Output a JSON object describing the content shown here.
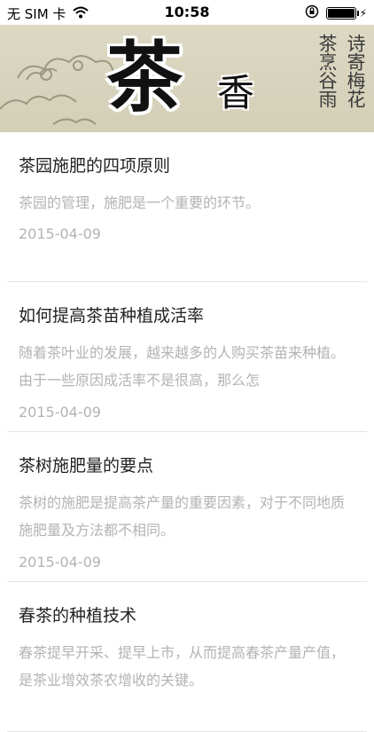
{
  "status_bar": {
    "carrier": "无 SIM 卡",
    "time": "10:58",
    "wifi_icon": "wifi-icon",
    "rotation_lock_icon": "rotation-lock-icon",
    "battery_icon": "battery-icon",
    "charging_icon": "charging-bolt-icon"
  },
  "banner": {
    "title": "茶",
    "subtitle": "香",
    "poem_columns": [
      "诗寄梅花",
      "茶烹谷雨"
    ]
  },
  "articles": [
    {
      "title": "茶园施肥的四项原则",
      "summary": "茶园的管理，施肥是一个重要的环节。",
      "date": "2015-04-09"
    },
    {
      "title": "如何提高茶苗种植成活率",
      "summary": "随着茶叶业的发展，越来越多的人购买茶苗来种植。由于一些原因成活率不是很高，那么怎",
      "date": "2015-04-09"
    },
    {
      "title": "茶树施肥量的要点",
      "summary": "茶树的施肥是提高茶产量的重要因素，对于不同地质施肥量及方法都不相同。",
      "date": "2015-04-09"
    },
    {
      "title": "春茶的种植技术",
      "summary": "春茶提早开采、提早上市，从而提高春茶产量产值，是茶业增效茶农增收的关键。",
      "date": ""
    }
  ]
}
